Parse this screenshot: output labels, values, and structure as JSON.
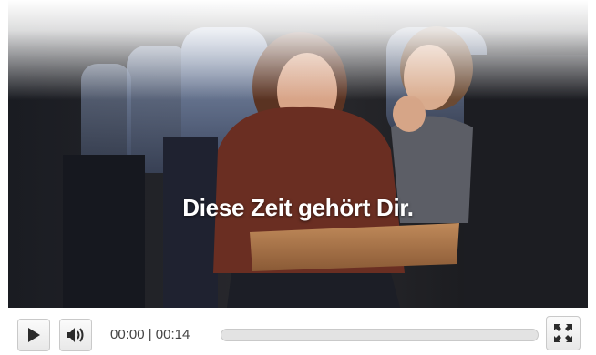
{
  "video": {
    "subtitle": "Diese Zeit gehört Dir."
  },
  "controls": {
    "current_time": "00:00",
    "separator": "|",
    "duration": "00:14",
    "progress_fraction": 0,
    "icons": {
      "play": "play-icon",
      "volume": "volume-icon",
      "fullscreen": "fullscreen-icon"
    }
  }
}
